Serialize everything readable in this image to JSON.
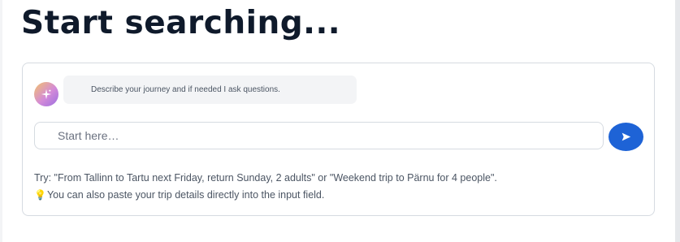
{
  "page": {
    "title": "Start searching..."
  },
  "assistant": {
    "avatar_icon": "sparkle-icon",
    "message": "Describe your journey and if needed I ask questions."
  },
  "composer": {
    "placeholder": "Start here…",
    "value": "",
    "send_icon": "send-arrow-icon"
  },
  "hints": {
    "example": "Try: \"From Tallinn to Tartu next Friday, return Sunday, 2 adults\" or \"Weekend trip to Pärnu for 4 people\".",
    "paste_tip": "You can also paste your trip details directly into the input field.",
    "tip_icon": "lightbulb-icon"
  },
  "colors": {
    "title": "#0f1a2b",
    "accent": "#1e63d6",
    "bubble_bg": "#f3f4f6",
    "border": "#d6dbe1"
  }
}
